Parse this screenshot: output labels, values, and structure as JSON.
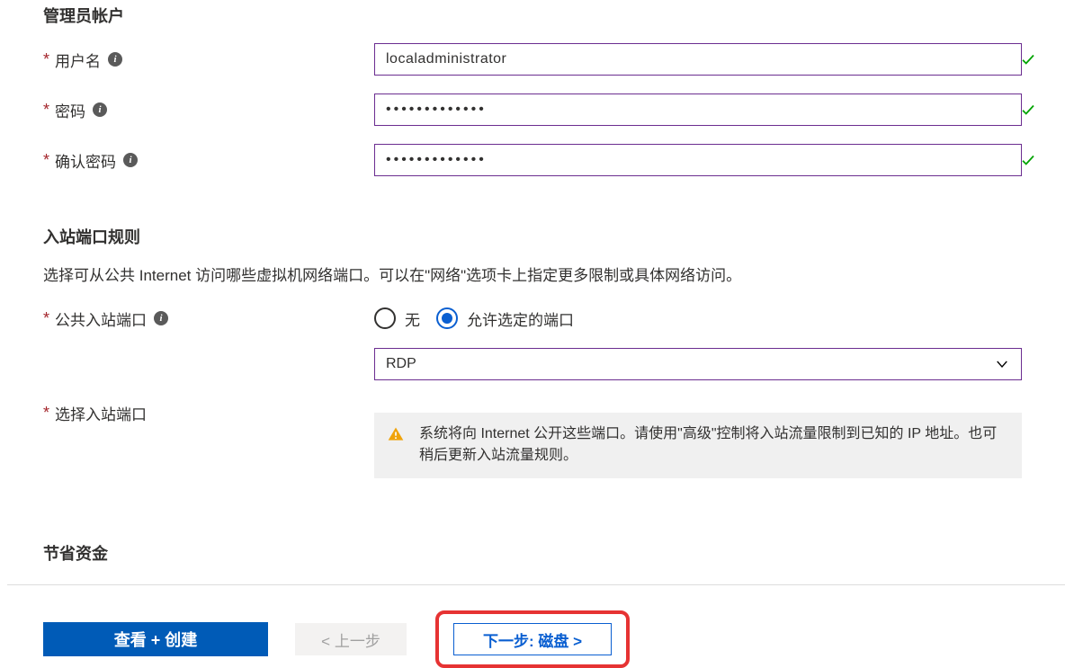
{
  "admin": {
    "title": "管理员帐户",
    "usernameLabel": "用户名",
    "usernameValue": "localadministrator",
    "passwordLabel": "密码",
    "passwordValue": "•••••••••••••",
    "confirmLabel": "确认密码",
    "confirmValue": "•••••••••••••"
  },
  "inbound": {
    "title": "入站端口规则",
    "desc": "选择可从公共 Internet 访问哪些虚拟机网络端口。可以在\"网络\"选项卡上指定更多限制或具体网络访问。",
    "publicLabel": "公共入站端口",
    "radioNone": "无",
    "radioAllow": "允许选定的端口",
    "selectLabel": "选择入站端口",
    "selectValue": "RDP",
    "warning": "系统将向 Internet 公开这些端口。请使用\"高级\"控制将入站流量限制到已知的 IP 地址。也可稍后更新入站流量规则。"
  },
  "saveMoney": {
    "title": "节省资金"
  },
  "footer": {
    "review": "查看 + 创建",
    "prev": "< 上一步",
    "next": "下一步: 磁盘 >"
  }
}
